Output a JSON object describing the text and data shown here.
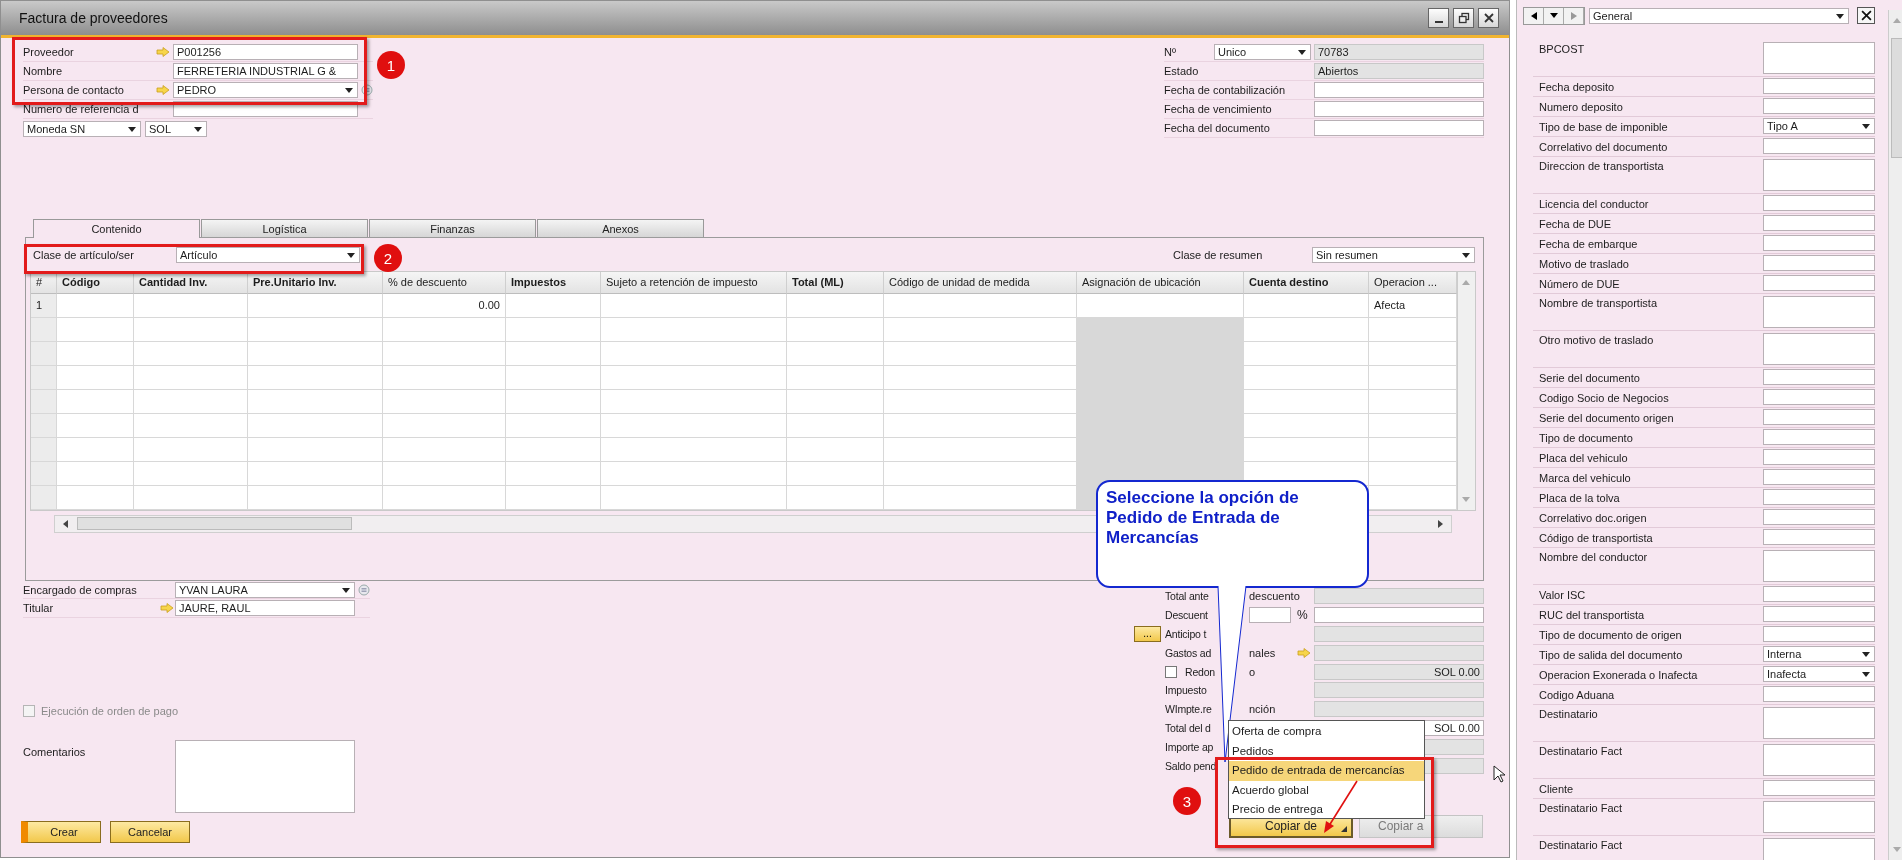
{
  "window": {
    "title": "Factura de proveedores"
  },
  "header_left": [
    {
      "label": "Proveedor",
      "link": true,
      "kind": "text",
      "value": "P001256"
    },
    {
      "label": "Nombre",
      "link": false,
      "kind": "text",
      "value": "FERRETERIA INDUSTRIAL G &"
    },
    {
      "label": "Persona de contacto",
      "link": true,
      "kind": "select",
      "value": "PEDRO"
    },
    {
      "label": "Numero de referencia d",
      "link": false,
      "kind": "text"
    }
  ],
  "currency": {
    "selector": "Moneda SN",
    "value": "SOL"
  },
  "header_right": [
    {
      "label": "Nº",
      "series": "Unico",
      "value": "70783",
      "readonly": true
    },
    {
      "label": "Estado",
      "value": "Abiertos",
      "readonly": true
    },
    {
      "label": "Fecha de contabilización",
      "readonly": false
    },
    {
      "label": "Fecha de vencimiento",
      "readonly": false
    },
    {
      "label": "Fecha del documento",
      "readonly": false
    }
  ],
  "tabs": [
    {
      "label": "Contenido",
      "selected": true
    },
    {
      "label": "Logística",
      "selected": false
    },
    {
      "label": "Finanzas",
      "selected": false
    },
    {
      "label": "Anexos",
      "selected": false
    }
  ],
  "item_type": {
    "label": "Clase de artículo/ser",
    "value": "Artículo"
  },
  "summary_type": {
    "label": "Clase de resumen",
    "value": "Sin resumen"
  },
  "table": {
    "columns": [
      {
        "label": "#",
        "bold": false,
        "disabled": false
      },
      {
        "label": "Código",
        "bold": true,
        "disabled": false
      },
      {
        "label": "Cantidad Inv.",
        "bold": true,
        "disabled": false
      },
      {
        "label": "Pre.Unitario Inv.",
        "bold": true,
        "disabled": false
      },
      {
        "label": "% de descuento",
        "bold": false,
        "disabled": false
      },
      {
        "label": "Impuestos",
        "bold": true,
        "disabled": false
      },
      {
        "label": "Sujeto a retención de impuesto",
        "bold": false,
        "disabled": false
      },
      {
        "label": "Total (ML)",
        "bold": true,
        "disabled": false
      },
      {
        "label": "Código de unidad de medida",
        "bold": false,
        "disabled": false
      },
      {
        "label": "Asignación de ubicación",
        "bold": false,
        "disabled": true
      },
      {
        "label": "Cuenta destino",
        "bold": true,
        "disabled": false
      },
      {
        "label": "Operacion ...",
        "bold": false,
        "disabled": false
      }
    ],
    "rows": [
      {
        "number": "1",
        "discount": "0.00",
        "operation": "Afecta"
      }
    ]
  },
  "buyer": {
    "label": "Encargado de compras",
    "value": "YVAN LAURA"
  },
  "owner": {
    "label": "Titular",
    "value": "JAURE, RAUL"
  },
  "payment_order": {
    "label": "Ejecución de orden de pago",
    "checked": false,
    "disabled": true
  },
  "comments": {
    "label": "Comentarios"
  },
  "buttons": [
    {
      "label": "Crear",
      "default": true
    },
    {
      "label": "Cancelar",
      "default": false
    }
  ],
  "totals": [
    {
      "kind": "plain",
      "label": "Total ante",
      "label_after": "descuento",
      "readonly": true
    },
    {
      "kind": "discount",
      "label": "Descuent",
      "unit": "%",
      "readonly": false
    },
    {
      "kind": "button",
      "label": "Anticipo t",
      "button": "...",
      "readonly": true
    },
    {
      "kind": "link",
      "label": "Gastos ad",
      "label_after": "nales",
      "readonly": true
    },
    {
      "kind": "check",
      "label": "Redon",
      "label_after": "o",
      "checked": false,
      "value": "SOL 0.00",
      "readonly": true
    },
    {
      "kind": "plain",
      "label": "Impuesto",
      "readonly": true
    },
    {
      "kind": "plain",
      "label": "WImpte.re",
      "label_after": "nción",
      "readonly": true
    },
    {
      "kind": "plain",
      "label": "Total del d",
      "value": "SOL 0.00",
      "readonly": false
    },
    {
      "kind": "plain",
      "label": "Importe ap",
      "readonly": true
    },
    {
      "kind": "plain",
      "label": "Saldo pend",
      "readonly": true
    }
  ],
  "copy_menu": [
    {
      "label": "Oferta de compra",
      "selected": false
    },
    {
      "label": "Pedidos",
      "selected": false
    },
    {
      "label": "Pedido de entrada de mercancías",
      "selected": true
    },
    {
      "label": "Acuerdo global",
      "selected": false
    },
    {
      "label": "Precio de entrega",
      "selected": false
    }
  ],
  "copy_buttons": [
    {
      "label": "Copiar de",
      "disabled": false
    },
    {
      "label": "Copiar a",
      "disabled": true
    }
  ],
  "annotations": {
    "markers": [
      "1",
      "2",
      "3"
    ],
    "callout": "Seleccione la opción de Pedido de Entrada de Mercancías"
  },
  "side_panel": {
    "view": "General",
    "fields": [
      {
        "label": "BPCOST",
        "kind": "tall"
      },
      {
        "label": "Fecha deposito",
        "kind": "text"
      },
      {
        "label": "Numero deposito",
        "kind": "text"
      },
      {
        "label": "Tipo de base de imponible",
        "kind": "select",
        "value": "Tipo A"
      },
      {
        "label": "Correlativo del documento",
        "kind": "text"
      },
      {
        "label": "Direccion de transportista",
        "kind": "tall"
      },
      {
        "label": "Licencia del conductor",
        "kind": "text"
      },
      {
        "label": "Fecha de DUE",
        "kind": "text"
      },
      {
        "label": "Fecha de embarque",
        "kind": "text"
      },
      {
        "label": "Motivo de traslado",
        "kind": "text"
      },
      {
        "label": "Número de DUE",
        "kind": "text"
      },
      {
        "label": "Nombre de transportista",
        "kind": "tall"
      },
      {
        "label": "Otro motivo de traslado",
        "kind": "tall"
      },
      {
        "label": "Serie del documento",
        "kind": "text"
      },
      {
        "label": "Codigo Socio de Negocios",
        "kind": "text"
      },
      {
        "label": "Serie del documento origen",
        "kind": "text"
      },
      {
        "label": "Tipo de documento",
        "kind": "text"
      },
      {
        "label": "Placa del vehiculo",
        "kind": "text"
      },
      {
        "label": "Marca del vehiculo",
        "kind": "text"
      },
      {
        "label": "Placa de la tolva",
        "kind": "text"
      },
      {
        "label": "Correlativo doc.origen",
        "kind": "text"
      },
      {
        "label": "Código de transportista",
        "kind": "text"
      },
      {
        "label": "Nombre del conductor",
        "kind": "tall"
      },
      {
        "label": "Valor ISC",
        "kind": "text"
      },
      {
        "label": "RUC del transportista",
        "kind": "text"
      },
      {
        "label": "Tipo de documento de origen",
        "kind": "text"
      },
      {
        "label": "Tipo de salida del documento",
        "kind": "select",
        "value": "Interna"
      },
      {
        "label": "Operacion Exonerada o Inafecta",
        "kind": "select",
        "value": "Inafecta"
      },
      {
        "label": "Codigo Aduana",
        "kind": "text"
      },
      {
        "label": "Destinatario",
        "kind": "tall"
      },
      {
        "label": "Destinatario Fact",
        "kind": "tall"
      },
      {
        "label": "Cliente",
        "kind": "text"
      },
      {
        "label": "Destinatario Fact",
        "kind": "tall"
      },
      {
        "label": "Destinatario Fact",
        "kind": "tall"
      }
    ]
  }
}
